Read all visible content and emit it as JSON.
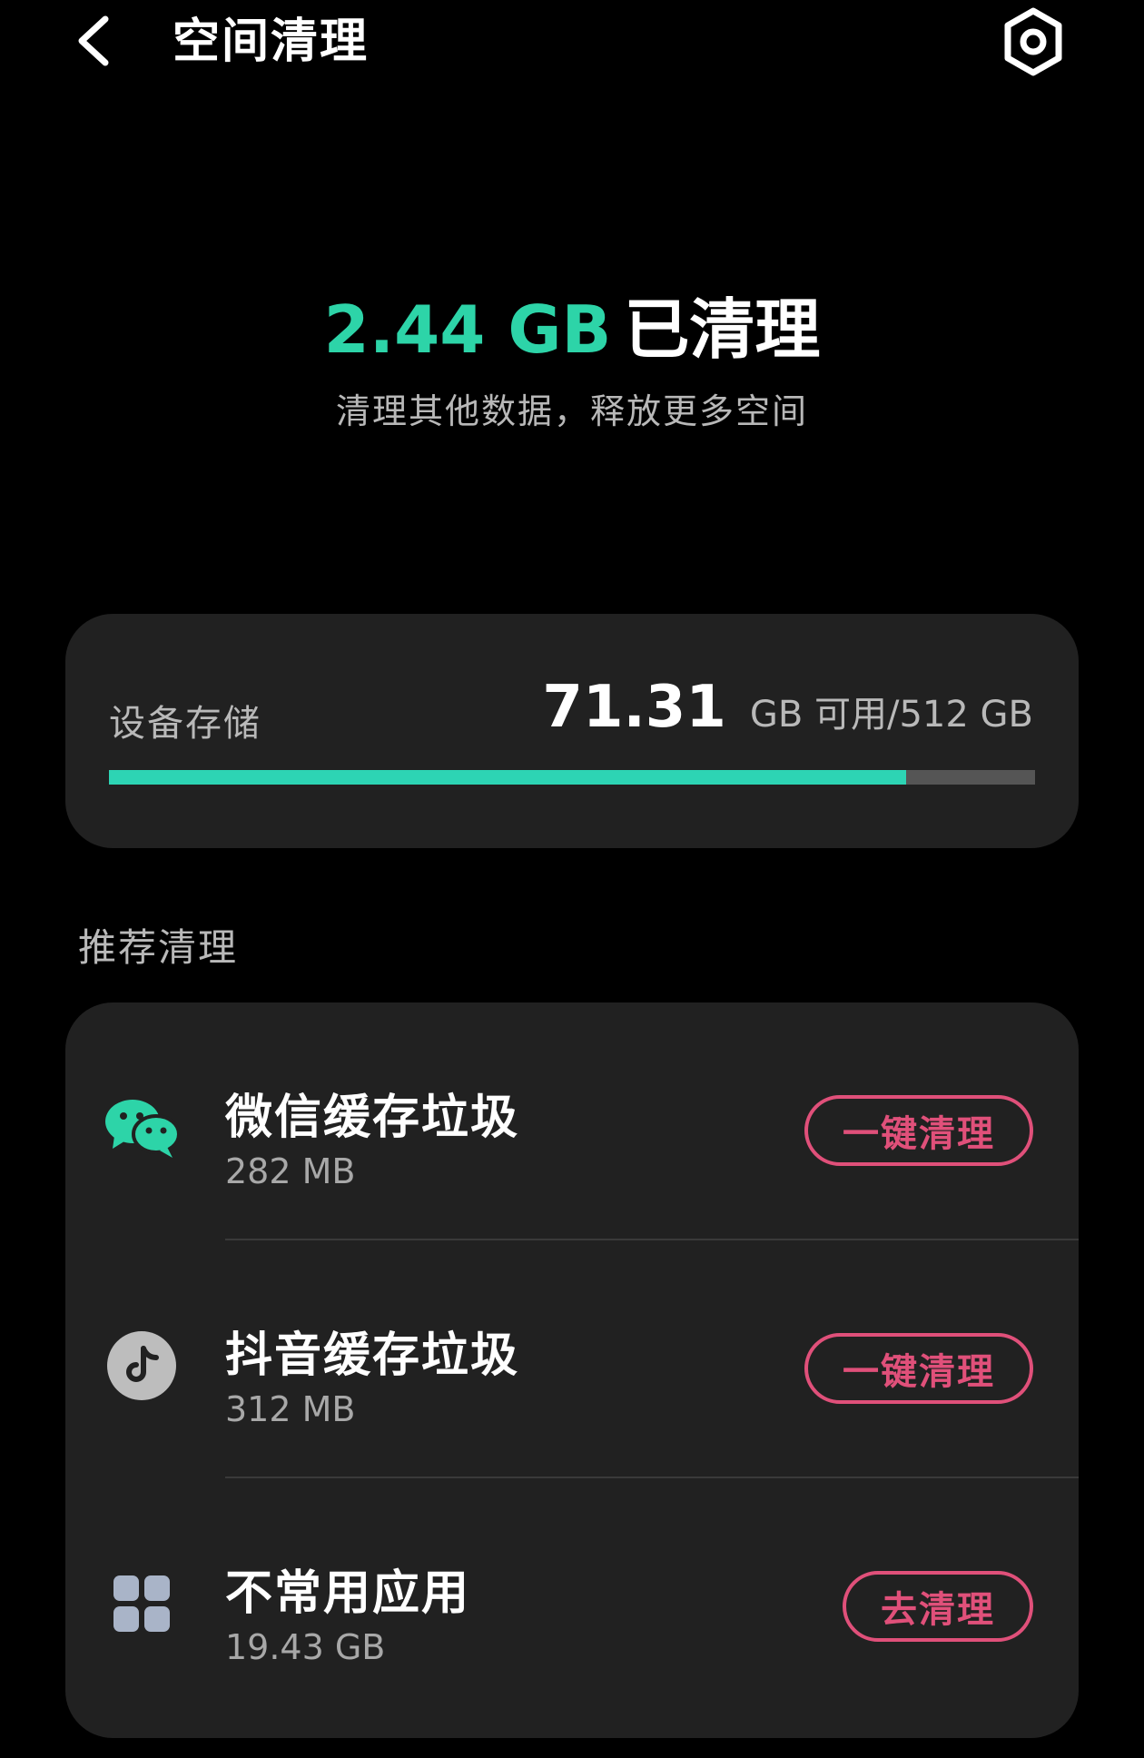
{
  "header": {
    "title": "空间清理",
    "back_icon": "chevron-left-icon",
    "settings_icon": "hexagon-gear-icon"
  },
  "summary": {
    "cleaned_amount": "2.44 GB",
    "cleaned_suffix": "已清理",
    "subtitle": "清理其他数据，释放更多空间",
    "accent_color": "#2dd4a8"
  },
  "storage": {
    "label": "设备存储",
    "available": "71.31",
    "unit_text": "GB 可用/512 GB",
    "used_fraction": 0.861,
    "bar_color": "#2dd4b4",
    "track_color": "#555555"
  },
  "recommend": {
    "section_title": "推荐清理",
    "items": [
      {
        "name": "微信缓存垃圾",
        "size": "282 MB",
        "action": "一键清理",
        "icon": "wechat-icon",
        "icon_color": "#2dd4a8"
      },
      {
        "name": "抖音缓存垃圾",
        "size": "312 MB",
        "action": "一键清理",
        "icon": "tiktok-icon",
        "icon_color": "#bdbdbd"
      },
      {
        "name": "不常用应用",
        "size": "19.43 GB",
        "action": "去清理",
        "icon": "apps-grid-icon",
        "icon_color": "#a9b4c8"
      }
    ],
    "button_color": "#e0507a"
  }
}
